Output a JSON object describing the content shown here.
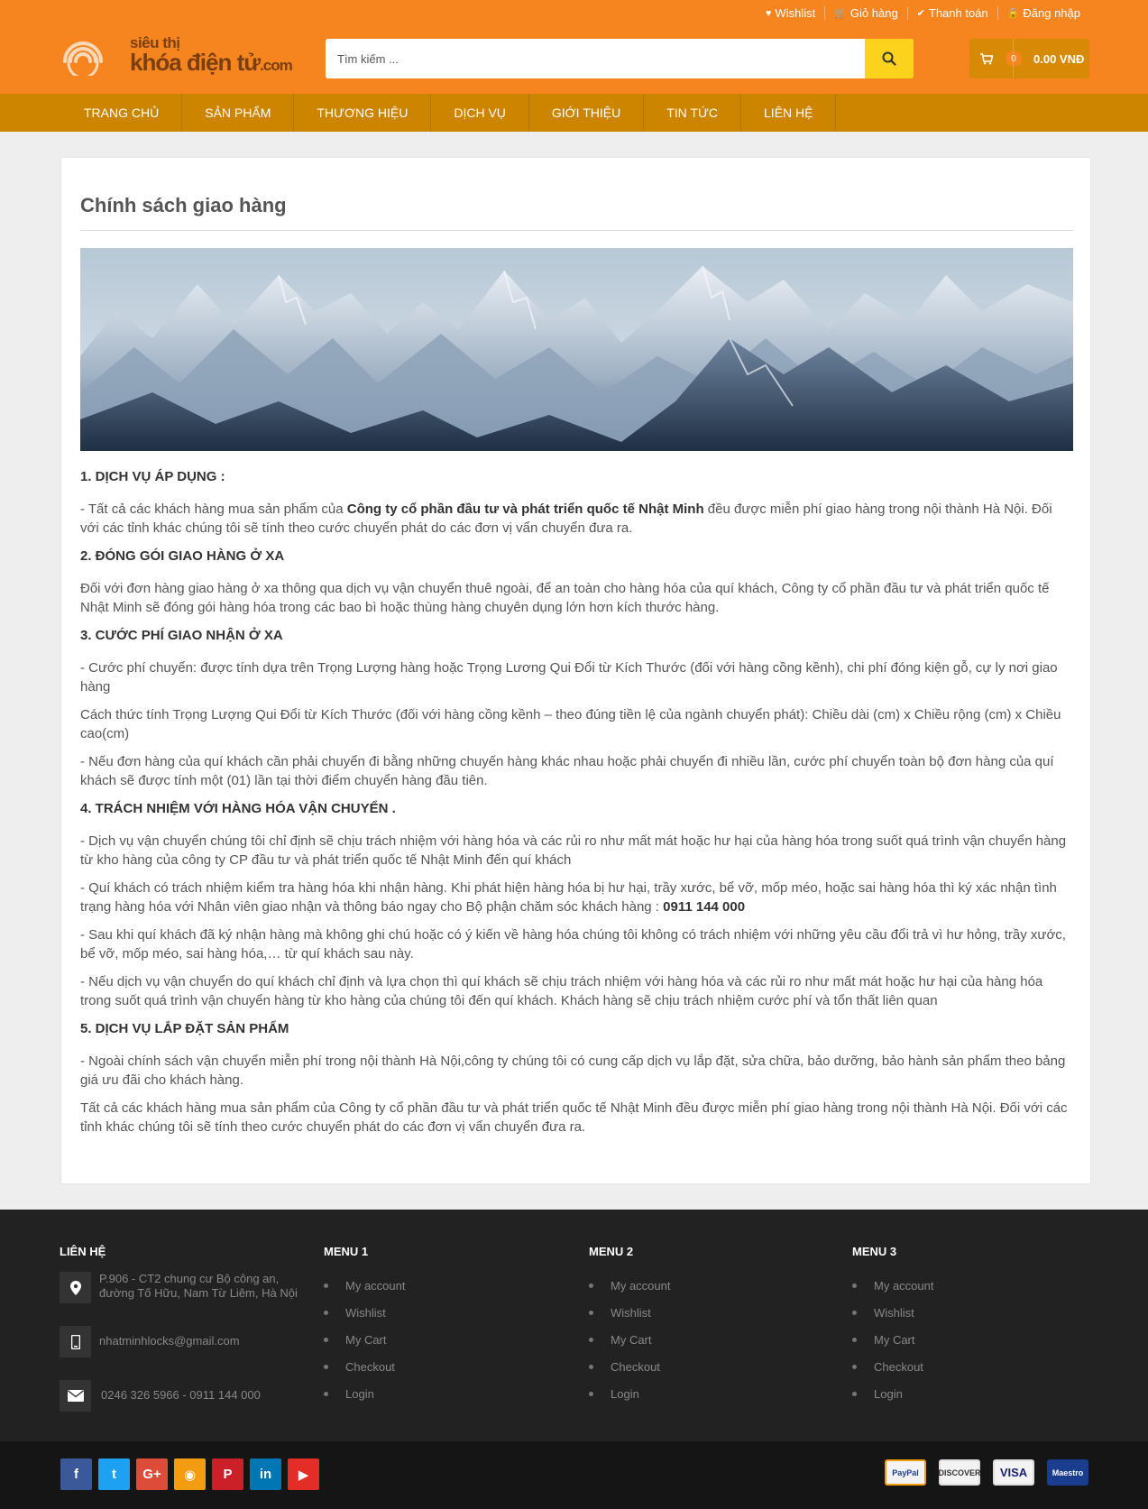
{
  "toplinks": [
    {
      "icon": "heart-icon",
      "glyph": "♥",
      "label": "Wishlist"
    },
    {
      "icon": "cart-icon",
      "glyph": "🛒",
      "label": "Giỏ hàng"
    },
    {
      "icon": "check-icon",
      "glyph": "✔",
      "label": "Thanh toán"
    },
    {
      "icon": "lock-icon",
      "glyph": "🔒",
      "label": "Đăng nhập"
    }
  ],
  "logo": {
    "line1": "siêu thị",
    "line2": "khóa điện tử",
    "suffix": ".com"
  },
  "search": {
    "placeholder": "Tìm kiếm ..."
  },
  "cart": {
    "count": "0",
    "amount": "0.00 VNĐ"
  },
  "nav": [
    "TRANG CHỦ",
    "SẢN PHẨM",
    "THƯƠNG HIỆU",
    "DỊCH VỤ",
    "GIỚI THIỆU",
    "TIN TỨC",
    "LIÊN HỆ"
  ],
  "page": {
    "title": "Chính sách giao hàng",
    "sections": [
      {
        "heading": "1.  DỊCH VỤ ÁP DỤNG :",
        "p1_pre": "- Tất cả các khách hàng mua sản phẩm của ",
        "p1_bold": "Công ty cổ phần đầu tư và phát triển quốc tế Nhật Minh",
        "p1_post": " đều được miễn phí giao hàng trong nội thành Hà Nội. Đối với các tỉnh khác chúng tôi sẽ tính theo cước chuyển phát do các đơn vị vẩn chuyển đưa ra."
      },
      {
        "heading": "2. ĐÓNG GÓI GIAO HÀNG Ở XA",
        "p1": "Đối với đơn hàng giao hàng ở xa thông qua dịch vụ vận chuyển thuê ngoài, để an toàn cho hàng hóa của quí khách, Công ty cổ phần đầu tư và phát triển quốc tế Nhật Minh sẽ đóng gói hàng hóa trong các bao bì hoặc thùng hàng chuyên dụng lớn hơn kích thước hàng."
      },
      {
        "heading": "3. CƯỚC PHÍ GIAO NHẬN Ở XA",
        "p1": "- Cước phí chuyển: được tính dựa trên Trọng Lượng hàng hoặc Trọng Lương Qui Đổi từ Kích Thước (đối với hàng cồng kềnh), chi phí đóng kiện gỗ, cự ly nơi giao hàng",
        "p2": " Cách thức tính Trọng Lượng Qui Đổi từ Kích Thước (đối với hàng cồng kềnh – theo đúng tiền lệ của ngành chuyển phát): Chiều dài (cm) x Chiều rộng (cm) x Chiều cao(cm)",
        "p3": "- Nếu đơn hàng của quí khách cần phải chuyển đi bằng những chuyến hàng khác nhau hoặc phải chuyển đi nhiều lần, cước phí chuyển toàn bộ đơn hàng của quí khách sẽ được tính một (01) lần tại thời điểm chuyển hàng đầu tiên."
      },
      {
        "heading": "4. TRÁCH NHIỆM VỚI HÀNG HÓA VẬN CHUYỂN .",
        "p1": "- Dịch vụ vận chuyển chúng tôi chỉ định sẽ chịu trách nhiệm với hàng hóa và các rủi ro như mất mát hoặc hư hại của hàng hóa trong suốt quá trình vận chuyển hàng từ kho hàng của công ty CP đầu tư và phát triển quốc tế Nhật Minh đến quí khách",
        "p2_pre": "- Quí khách có trách nhiệm kiểm tra hàng hóa khi nhận hàng. Khi phát hiện hàng hóa bị hư hại, trầy xước, bể vỡ, mốp méo, hoặc sai hàng hóa thì ký xác nhận tình trạng hàng hóa với Nhân viên giao nhận và thông báo ngay cho Bộ phận chăm sóc khách hàng : ",
        "p2_bold": "0911 144 000",
        "p3": "- Sau khi quí khách đã ký nhận hàng mà không ghi chú hoặc có ý kiến về hàng hóa chúng tôi không có trách nhiệm với những yêu cầu đổi trả vì hư hỏng, trầy xước, bể vỡ, mốp méo, sai hàng hóa,… từ quí khách sau này.",
        "p4": "- Nếu dịch vụ vận chuyển do quí khách chỉ định và lựa chọn thì quí khách sẽ chịu trách nhiệm với hàng hóa và các rủi ro như mất mát hoặc hư hại của hàng hóa trong suốt quá trình vận chuyển hàng từ kho hàng của chúng tôi đến quí khách. Khách hàng sẽ chịu trách nhiệm cước phí và tổn thất liên quan"
      },
      {
        "heading": "5. DỊCH VỤ LẮP ĐẶT SẢN PHẨM",
        "p1": "-  Ngoài chính sách vận chuyển miễn phí trong nội thành Hà Nội,công ty chúng tôi có cung cấp dịch vụ lắp đặt, sửa chữa, bảo dưỡng, bảo hành sản phẩm theo bảng giá ưu đãi cho khách hàng.",
        "p2": "Tất cả các khách hàng mua sản phẩm của Công ty cổ phần đầu tư và phát triển quốc tế Nhật Minh đều được miễn phí giao hàng trong nội thành Hà Nội. Đối với các tỉnh khác chúng tôi sẽ tính theo cước chuyển phát do các đơn vị vẩn chuyển đưa ra."
      }
    ]
  },
  "footer": {
    "contact": {
      "heading": "LIÊN HỆ",
      "address": "P.906 - CT2 chung cư Bộ công an, đường Tố Hữu, Nam Từ Liêm, Hà Nội",
      "email": "nhatminhlocks@gmail.com",
      "phone": "0246 326 5966 - 0911 144 000"
    },
    "menus": [
      {
        "heading": "MENU 1",
        "items": [
          "My account",
          "Wishlist",
          "My Cart",
          "Checkout",
          "Login"
        ]
      },
      {
        "heading": "MENU 2",
        "items": [
          "My account",
          "Wishlist",
          "My Cart",
          "Checkout",
          "Login"
        ]
      },
      {
        "heading": "MENU 3",
        "items": [
          "My account",
          "Wishlist",
          "My Cart",
          "Checkout",
          "Login"
        ]
      }
    ]
  },
  "social": [
    {
      "name": "facebook-icon",
      "glyph": "f",
      "color": "#3b5998"
    },
    {
      "name": "twitter-icon",
      "glyph": "t",
      "color": "#1da1f2"
    },
    {
      "name": "google-plus-icon",
      "glyph": "G+",
      "color": "#dd4b39"
    },
    {
      "name": "rss-icon",
      "glyph": "◉",
      "color": "#f39c12"
    },
    {
      "name": "pinterest-icon",
      "glyph": "P",
      "color": "#cb2027"
    },
    {
      "name": "linkedin-icon",
      "glyph": "in",
      "color": "#0077b5"
    },
    {
      "name": "youtube-icon",
      "glyph": "▶",
      "color": "#e52d27"
    }
  ],
  "payments": [
    {
      "name": "paypal-icon",
      "label": "PayPal"
    },
    {
      "name": "discover-icon",
      "label": "DISCOVER"
    },
    {
      "name": "visa-icon",
      "label": "VISA"
    },
    {
      "name": "maestro-icon",
      "label": "Maestro"
    }
  ]
}
